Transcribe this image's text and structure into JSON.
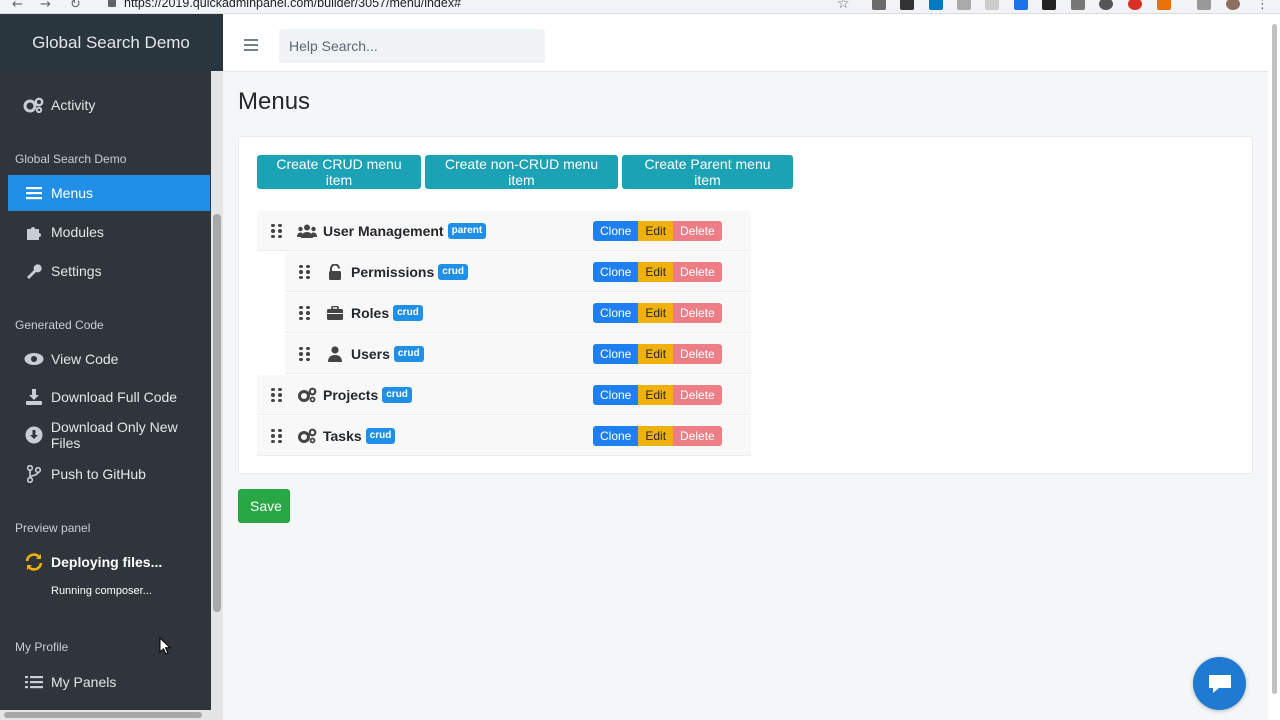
{
  "browser": {
    "url": "https://2019.quickadminpanel.com/builder/3057/menu/index#"
  },
  "sidebar": {
    "brand": "Global Search Demo",
    "activity_label": "Activity",
    "section_search": "Global Search Demo",
    "items_search": [
      {
        "label": "Menus",
        "icon": "list-icon",
        "active": true
      },
      {
        "label": "Modules",
        "icon": "puzzle-icon"
      },
      {
        "label": "Settings",
        "icon": "wrench-icon"
      }
    ],
    "section_generated": "Generated Code",
    "items_generated": [
      {
        "label": "View Code",
        "icon": "eye-icon"
      },
      {
        "label": "Download Full Code",
        "icon": "download-icon"
      },
      {
        "label": "Download Only New Files",
        "icon": "download-circle-icon"
      },
      {
        "label": "Push to GitHub",
        "icon": "git-branch-icon"
      }
    ],
    "section_preview": "Preview panel",
    "deploying_label": "Deploying files...",
    "deploying_sub": "Running composer...",
    "section_profile": "My Profile",
    "my_panels_label": "My Panels"
  },
  "header": {
    "search_placeholder": "Help Search..."
  },
  "main": {
    "title": "Menus",
    "create_buttons": {
      "crud": "Create CRUD menu item",
      "non_crud": "Create non-CRUD menu item",
      "parent": "Create Parent menu item"
    },
    "menu_items": [
      {
        "label": "User Management",
        "badge": "parent",
        "icon": "users-icon",
        "level": 0
      },
      {
        "label": "Permissions",
        "badge": "crud",
        "icon": "unlock-icon",
        "level": 1
      },
      {
        "label": "Roles",
        "badge": "crud",
        "icon": "briefcase-icon",
        "level": 1
      },
      {
        "label": "Users",
        "badge": "crud",
        "icon": "user-icon",
        "level": 1
      },
      {
        "label": "Projects",
        "badge": "crud",
        "icon": "cogs-icon",
        "level": 0
      },
      {
        "label": "Tasks",
        "badge": "crud",
        "icon": "cogs-icon",
        "level": 0
      }
    ],
    "action_labels": {
      "clone": "Clone",
      "edit": "Edit",
      "delete": "Delete"
    },
    "save_label": "Save"
  },
  "colors": {
    "sidebar_bg": "#2f353a",
    "active_item": "#1f8fe8",
    "info_button": "#1ba2b4",
    "success_button": "#28a745",
    "clone": "#1e80f0",
    "edit": "#f0b10c",
    "delete": "#ed7e86"
  }
}
